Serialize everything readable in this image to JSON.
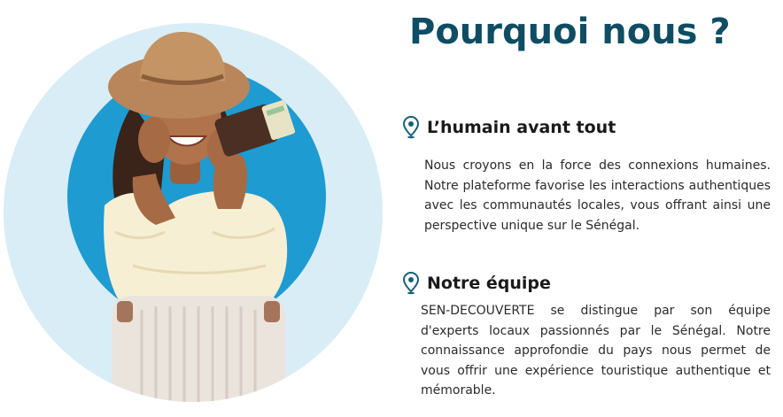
{
  "section": {
    "title": "Pourquoi nous ?"
  },
  "hero": {
    "image_alt": "Voyageuse souriante avec chapeau de paille, passeport et valise",
    "colors": {
      "outer_circle": "#d8edf6",
      "inner_circle": "#1e9bd1",
      "hat": "#b8865a",
      "blouse": "#f7efd4",
      "suitcase": "#ebe4dd"
    }
  },
  "features": [
    {
      "icon": "location-pin-icon",
      "title": "L’humain avant tout",
      "text": "Nous croyons en la force des connexions humaines. Notre plateforme favorise les interactions authentiques avec les communautés locales, vous offrant ainsi une perspective unique sur le Sénégal."
    },
    {
      "icon": "location-pin-icon",
      "title": "Notre équipe",
      "text": "SEN-DECOUVERTE se distingue par son équipe d'experts locaux passionnés par le Sénégal. Notre connaissance approfondie du pays nous permet de vous offrir une expérience touristique authentique et mémorable."
    }
  ],
  "colors": {
    "title": "#0e4d63",
    "pin": "#16607a",
    "body_text": "#2b2b2b"
  }
}
